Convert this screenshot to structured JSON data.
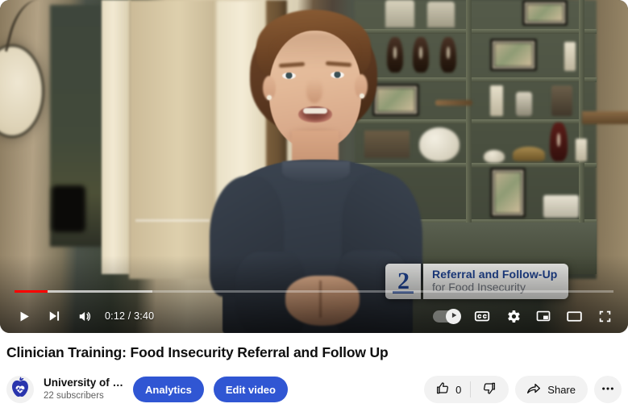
{
  "player": {
    "state": "paused",
    "time_display": "0:12 / 3:40",
    "current_time": "0:12",
    "duration": "3:40",
    "progress_percent": 5.5,
    "loaded_percent": 23,
    "progress_color": "#ff0000",
    "controls": {
      "play": "Play",
      "next": "Next",
      "volume": "Mute",
      "autoplay": "Autoplay is on",
      "subtitles": "Subtitles/closed captions (c)",
      "settings": "Settings",
      "miniplayer": "Miniplayer (i)",
      "theater": "Theater mode (t)",
      "fullscreen": "Full screen (f)"
    },
    "icons": {
      "play": "play-icon",
      "next": "next-track-icon",
      "volume": "volume-high-icon",
      "autoplay": "autoplay-toggle-icon",
      "subtitles": "closed-captions-icon",
      "settings": "gear-icon",
      "miniplayer": "miniplayer-icon",
      "theater": "theater-mode-icon",
      "fullscreen": "fullscreen-icon"
    },
    "overlay": {
      "number": "2",
      "title": "Referral and Follow-Up",
      "subtitle": "for Food Insecurity",
      "title_color": "#1d3f8a",
      "subtitle_color": "#6a6f78"
    }
  },
  "meta": {
    "title": "Clinician Training: Food Insecurity Referral and Follow Up",
    "channel_name": "University of …",
    "subscriber_count": "22 subscribers",
    "avatar_icon": "apple-heart-logo-icon",
    "avatar_color": "#2a35ad"
  },
  "buttons": {
    "analytics": "Analytics",
    "edit_video": "Edit video",
    "accent_color": "#3056d3",
    "like_count": "0",
    "like_icon": "thumbs-up-icon",
    "dislike_icon": "thumbs-down-icon",
    "share": "Share",
    "share_icon": "share-arrow-icon",
    "more_actions_icon": "more-horizontal-icon"
  }
}
